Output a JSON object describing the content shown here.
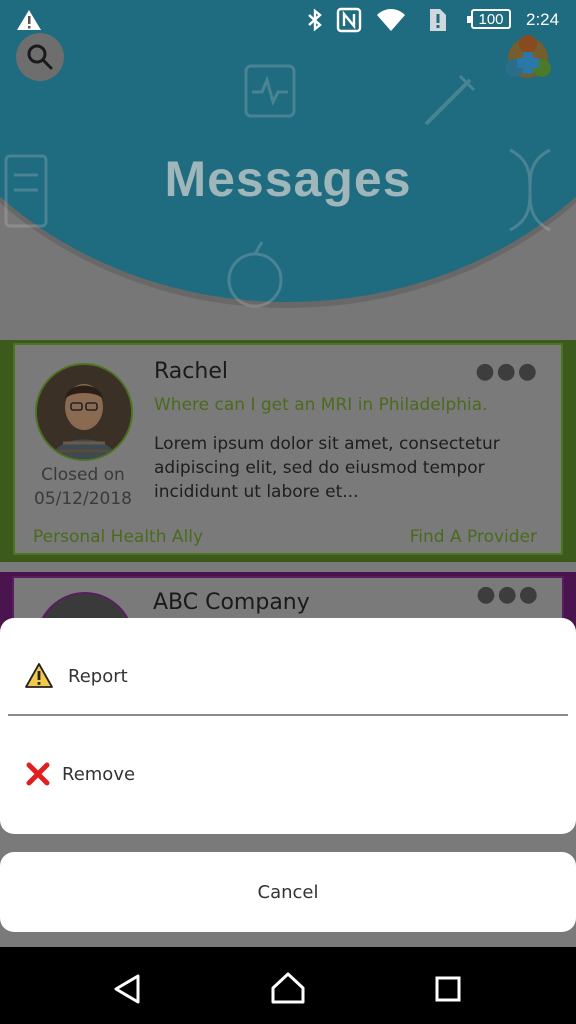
{
  "status_bar": {
    "battery": "100",
    "time": "2:24"
  },
  "header": {
    "title": "Messages"
  },
  "messages": [
    {
      "name": "Rachel",
      "subject": "Where can I get an MRI in Philadelphia.",
      "body": "Lorem ipsum dolor sit amet, consectetur adipiscing elit, sed do eiusmod tempor incididunt ut labore et...",
      "closed_label": "Closed on",
      "closed_date": "05/12/2018",
      "tag_left": "Personal Health Ally",
      "tag_right": "Find A Provider",
      "accent": "#4d7320"
    },
    {
      "name": "ABC Company",
      "accent": "#5a1d62"
    }
  ],
  "action_sheet": {
    "report_label": "Report",
    "remove_label": "Remove",
    "cancel_label": "Cancel"
  },
  "colors": {
    "header_teal": "#1f6b80",
    "warning_yellow": "#f2c94c",
    "remove_red": "#e02020"
  }
}
